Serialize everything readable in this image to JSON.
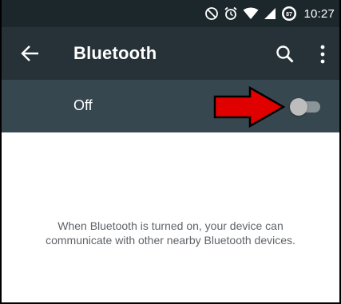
{
  "status_bar": {
    "time": "10:27",
    "battery_level": "87",
    "icons": [
      "do-not-disturb-icon",
      "alarm-icon",
      "wifi-icon",
      "signal-icon",
      "battery-icon"
    ]
  },
  "app_bar": {
    "title": "Bluetooth",
    "icons": [
      "back-arrow-icon",
      "search-icon",
      "more-vert-icon"
    ]
  },
  "toggle": {
    "label": "Off",
    "state": "off"
  },
  "content": {
    "line1": "When Bluetooth is turned on, your device can",
    "line2": "communicate with other nearby Bluetooth devices."
  },
  "annotation": {
    "arrow_color": "#e00000",
    "arrow_outline": "#000000"
  },
  "colors": {
    "status_bar": "#1c272c",
    "app_bar": "#263238",
    "toggle_bar": "#37474f",
    "content_bg": "#ffffff",
    "text_secondary": "#5f6368"
  }
}
